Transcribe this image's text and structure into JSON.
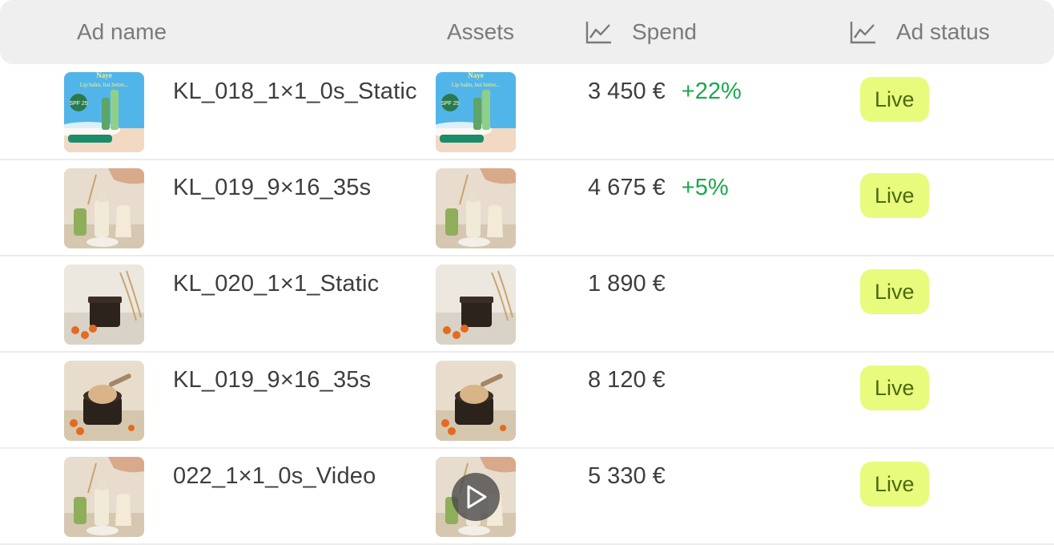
{
  "header": {
    "ad_name": "Ad name",
    "assets": "Assets",
    "spend": "Spend",
    "ad_status": "Ad status"
  },
  "rows": [
    {
      "name": "KL_018_1×1_0s_Static",
      "spend": "3 450 €",
      "delta": "+22%",
      "status": "Live",
      "thumb": "lip-balm-ad-image",
      "thumb_text_title": "Naye",
      "thumb_text_sub": "Lip balm, but better...",
      "thumb_badge": "SPF 25"
    },
    {
      "name": "KL_019_9×16_35s",
      "spend": "4 675 €",
      "delta": "+5%",
      "status": "Live",
      "thumb": "serum-bottles-image"
    },
    {
      "name": "KL_020_1×1_Static",
      "spend": "1 890 €",
      "delta": "",
      "status": "Live",
      "thumb": "cream-jar-image"
    },
    {
      "name": "KL_019_9×16_35s",
      "spend": "8 120 €",
      "delta": "",
      "status": "Live",
      "thumb": "open-cream-jar-image"
    },
    {
      "name": "022_1×1_0s_Video",
      "spend": "5 330 €",
      "delta": "",
      "status": "Live",
      "thumb": "serum-bottles-image",
      "asset_overlay": "play-icon"
    }
  ],
  "colors": {
    "header_bg": "#efefef",
    "status_bg": "#e8fb7d",
    "status_text": "#4b6a12",
    "delta_positive": "#1aa84b"
  }
}
